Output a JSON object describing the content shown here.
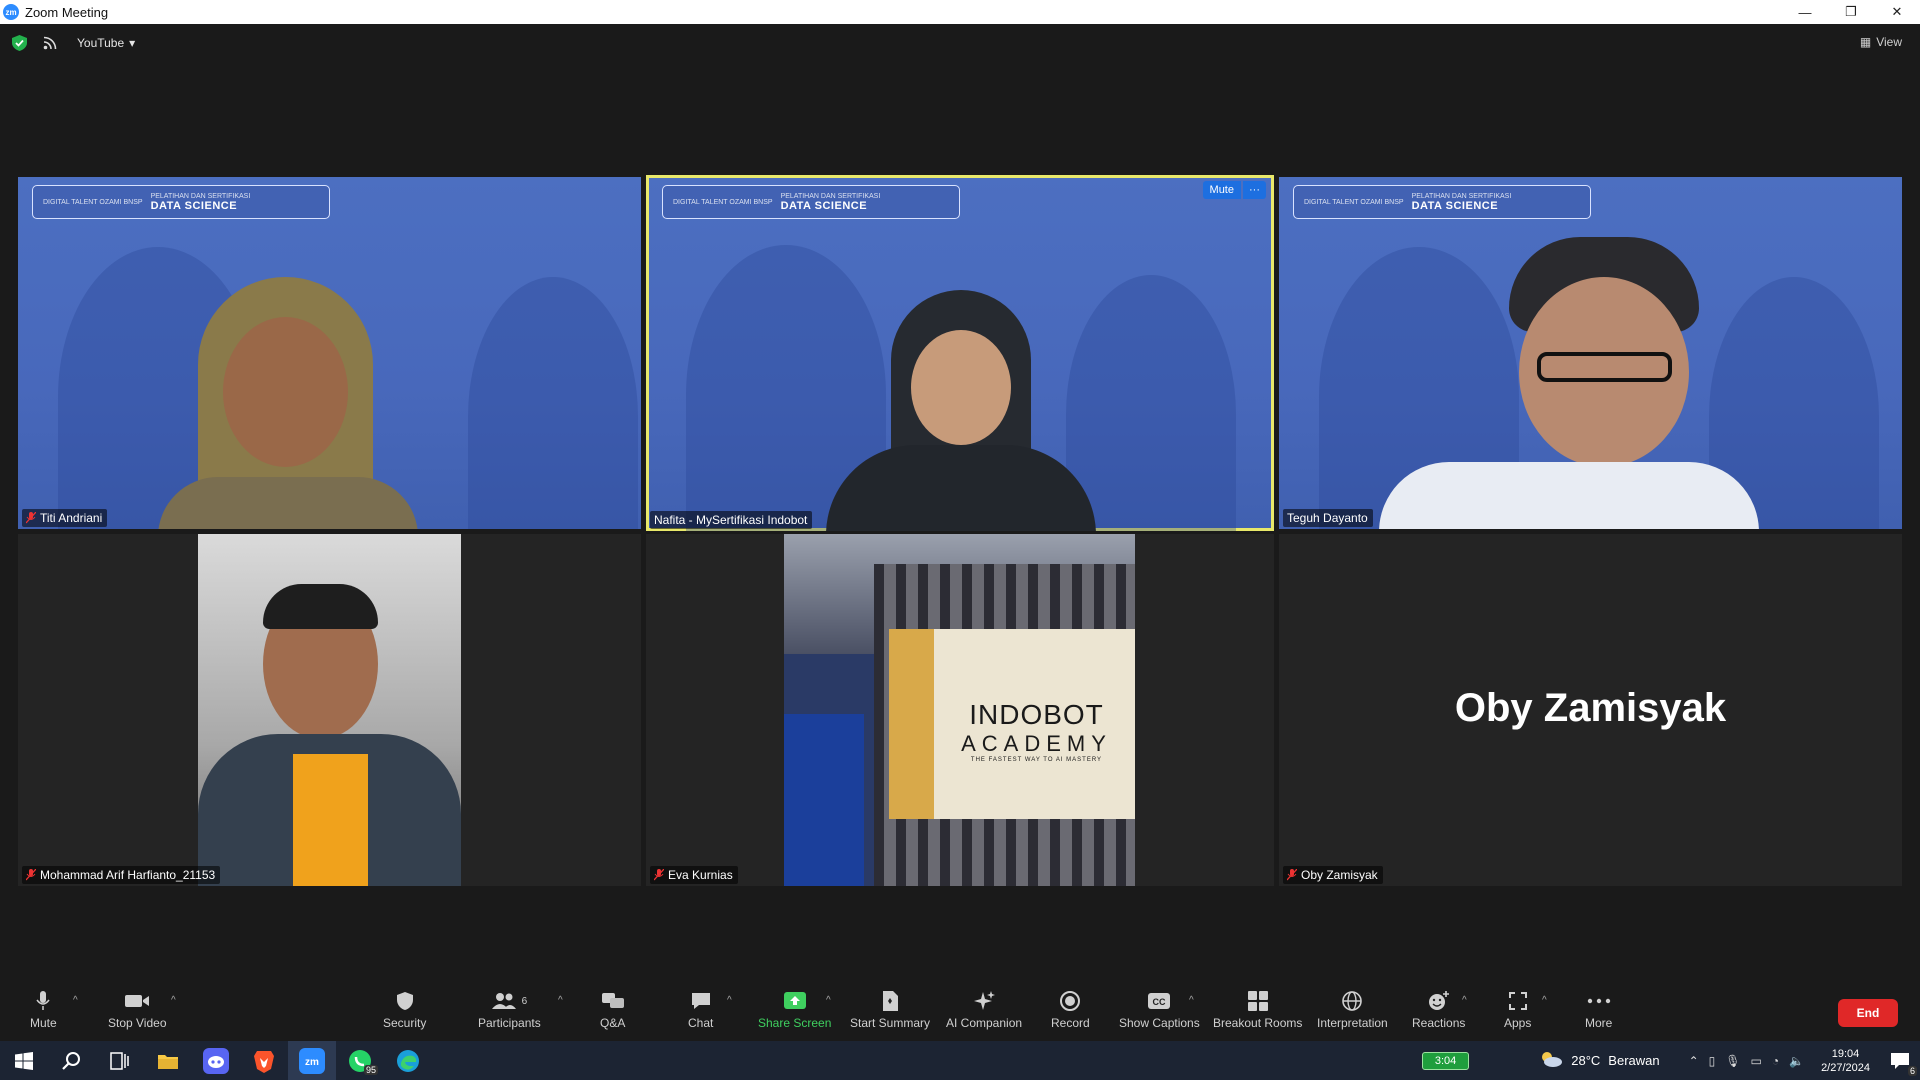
{
  "window": {
    "app_icon": "zoom-icon",
    "title": "Zoom Meeting",
    "minimize": "—",
    "restore": "❐",
    "close": "✕"
  },
  "topbar": {
    "live_label": "YouTube",
    "view_label": "View"
  },
  "banner": {
    "small_text": "PELATIHAN DAN SERTIFIKASI",
    "logos": "DIGITAL TALENT  OZAMI  BNSP",
    "big_text": "DATA SCIENCE"
  },
  "participants": [
    {
      "name": "Titi Andriani",
      "muted": true
    },
    {
      "name": "Nafita - MySertifikasi Indobot",
      "muted": false,
      "active_speaker": true
    },
    {
      "name": "Teguh Dayanto",
      "muted": false
    },
    {
      "name": "Mohammad Arif Harfianto_21153",
      "muted": true
    },
    {
      "name": "Eva Kurnias",
      "muted": true
    },
    {
      "name": "Oby Zamisyak",
      "muted": true,
      "avatar_text": "Oby Zamisyak"
    }
  ],
  "tile_controls": {
    "mute_label": "Mute",
    "more_label": "···"
  },
  "indobot_sign": {
    "line1": "INDOBOT",
    "line2": "ACADEMY",
    "tagline": "THE FASTEST WAY TO AI MASTERY"
  },
  "toolbar": {
    "mute": "Mute",
    "stop_video": "Stop Video",
    "security": "Security",
    "participants": "Participants",
    "participants_count": "6",
    "qa": "Q&A",
    "chat": "Chat",
    "share_screen": "Share Screen",
    "start_summary": "Start Summary",
    "ai_companion": "AI Companion",
    "record": "Record",
    "show_captions": "Show Captions",
    "breakout_rooms": "Breakout Rooms",
    "interpretation": "Interpretation",
    "reactions": "Reactions",
    "apps": "Apps",
    "more": "More",
    "end": "End"
  },
  "taskbar": {
    "whatsapp_badge": "95",
    "battery_label": "3:04",
    "weather_temp": "28°C",
    "weather_desc": "Berawan",
    "time": "19:04",
    "date": "2/27/2024",
    "notification_count": "6"
  },
  "colors": {
    "active_speaker_border": "#e8e86a",
    "share_green": "#3fcf5f",
    "end_red": "#e02828",
    "zoom_blue": "#2d8cff"
  }
}
